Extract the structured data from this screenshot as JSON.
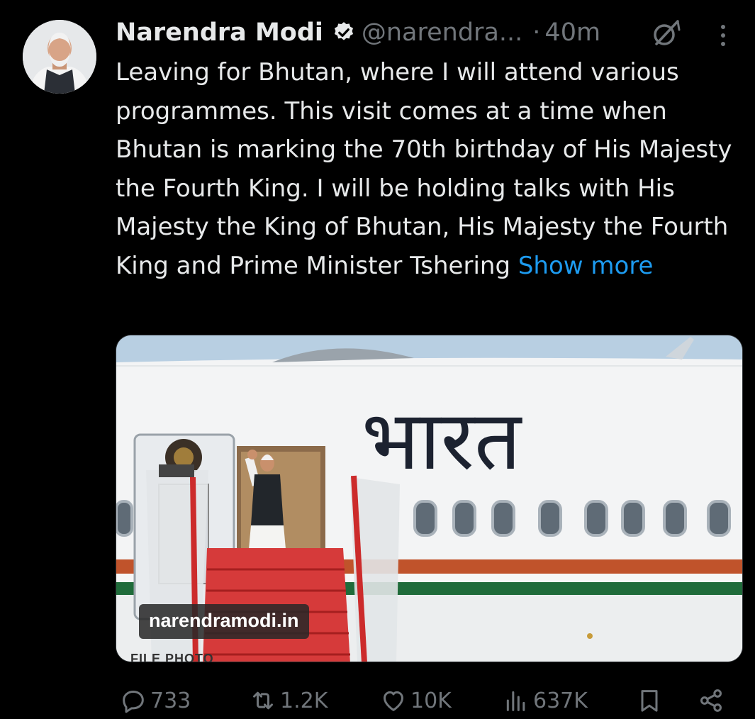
{
  "post": {
    "author_name": "Narendra Modi",
    "handle": "@narendra...",
    "separator": "·",
    "time": "40m",
    "text": "Leaving for Bhutan, where I will attend various programmes. This visit comes at a time when Bhutan is marking the 70th birthday of His Majesty the Fourth King. I will be holding talks with His Majesty the King of Bhutan, His Majesty the Fourth King and Prime Minister Tshering ",
    "show_more": "Show more",
    "media": {
      "aircraft_text": "भारत",
      "watermark": "narendramodi.in",
      "caption": "FILE PHOTO"
    }
  },
  "actions": {
    "replies": "733",
    "reposts": "1.2K",
    "likes": "10K",
    "views": "637K"
  },
  "icons": [
    "verified-badge-icon",
    "grok-icon",
    "more-options-icon",
    "reply-icon",
    "repost-icon",
    "like-icon",
    "views-icon",
    "bookmark-icon",
    "share-icon"
  ],
  "colors": {
    "background": "#000000",
    "text": "#e7e9ea",
    "muted": "#71767b",
    "link": "#1d9bf0"
  }
}
